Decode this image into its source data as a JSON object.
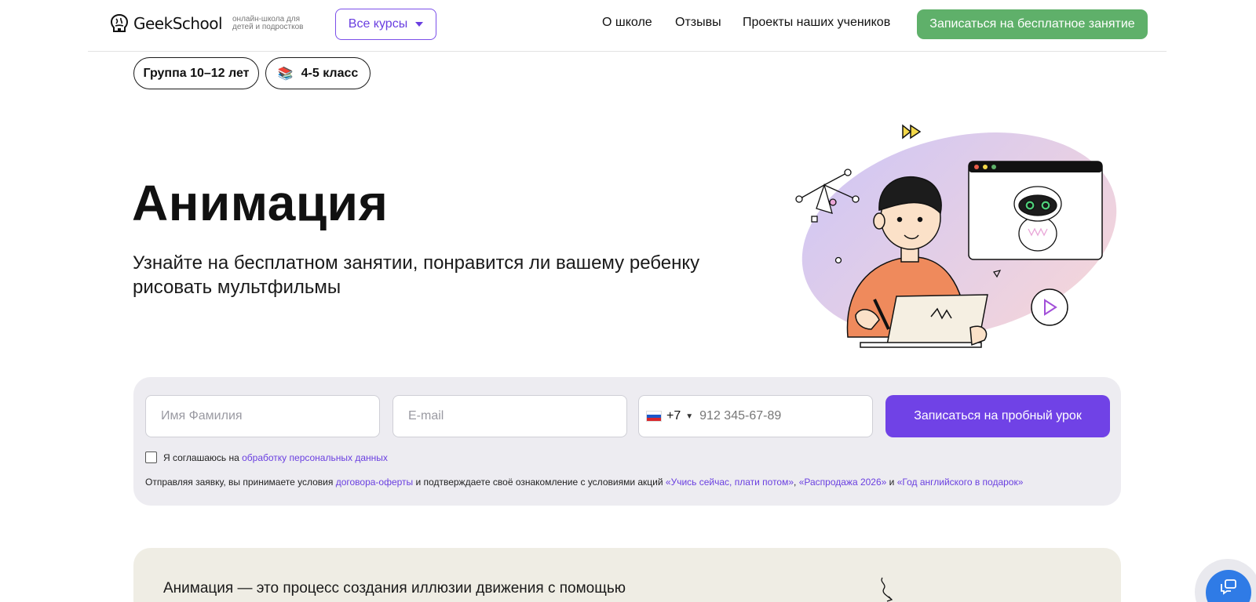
{
  "header": {
    "logo_text": "GeekSchool",
    "logo_sub": "онлайн-школа для детей и подростков",
    "all_courses": "Все курсы",
    "nav": [
      "О школе",
      "Отзывы",
      "Проекты наших учеников"
    ],
    "cta": "Записаться на бесплатное занятие"
  },
  "chips": {
    "group": "Группа 10–12 лет",
    "grade_emoji": "📚",
    "grade": "4-5 класс"
  },
  "hero": {
    "title": "Анимация",
    "subtitle": "Узнайте на бесплатном занятии, понравится ли вашему ребенку рисовать мультфильмы"
  },
  "form": {
    "name_placeholder": "Имя Фамилия",
    "email_placeholder": "E-mail",
    "phone_code": "+7",
    "phone_placeholder": "912 345-67-89",
    "submit": "Записаться на пробный урок",
    "agree_text": "Я соглашаюсь на ",
    "agree_link": "обработку персональных данных",
    "terms_prefix": "Отправляя заявку, вы принимаете условия ",
    "terms_link1": "договора-оферты",
    "terms_mid": " и подтверждаете своё ознакомление с условиями акций ",
    "terms_link2": "«Учись сейчас, плати потом»",
    "terms_comma": ", ",
    "terms_link3": "«Распродажа 2026»",
    "terms_and": " и ",
    "terms_link4": "«Год английского в подарок»"
  },
  "about": {
    "text": "Анимация — это процесс создания иллюзии движения с помощью серии последовательных изображений или объектов"
  },
  "colors": {
    "accent": "#7042e6",
    "green": "#5fb06a",
    "chat": "#2f7be6"
  }
}
